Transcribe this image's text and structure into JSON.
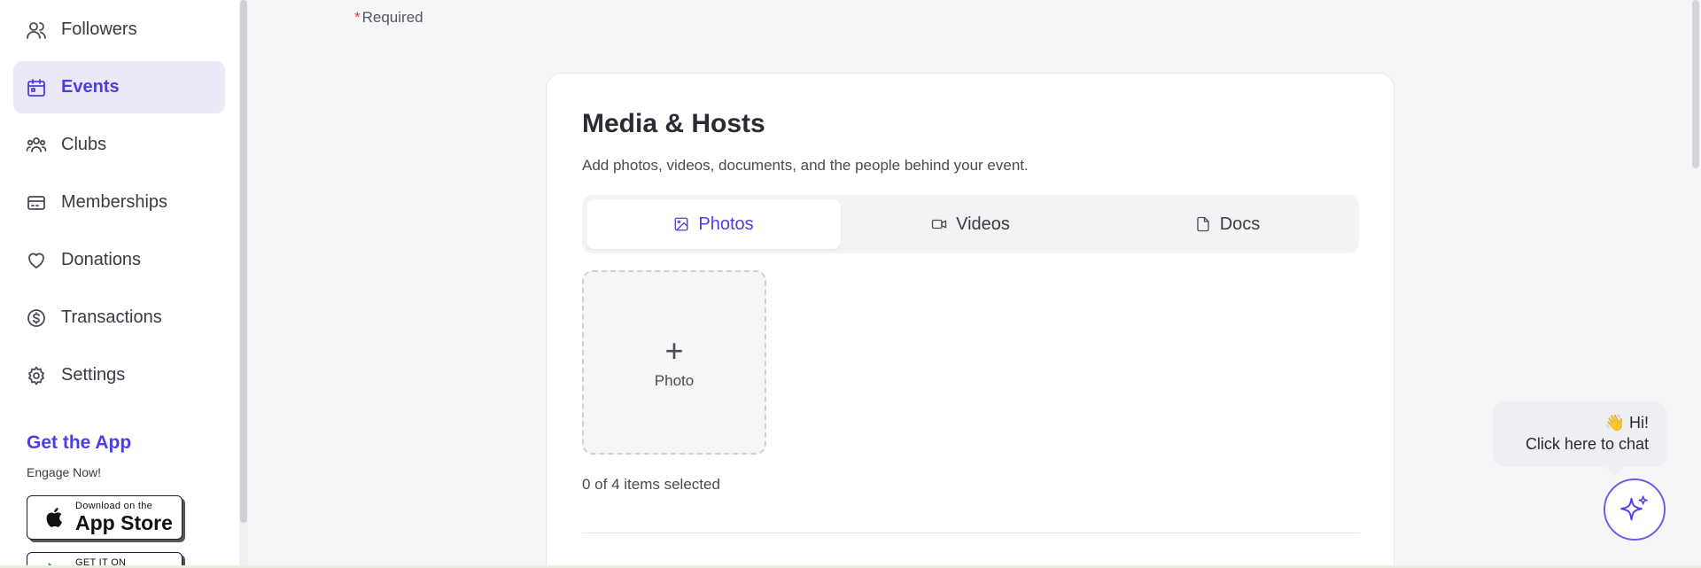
{
  "sidebar": {
    "items": [
      {
        "label": "Followers",
        "icon": "users-icon"
      },
      {
        "label": "Events",
        "icon": "calendar-icon",
        "active": true
      },
      {
        "label": "Clubs",
        "icon": "group-icon"
      },
      {
        "label": "Memberships",
        "icon": "card-icon"
      },
      {
        "label": "Donations",
        "icon": "heart-icon"
      },
      {
        "label": "Transactions",
        "icon": "dollar-circle-icon"
      },
      {
        "label": "Settings",
        "icon": "gear-icon"
      }
    ],
    "get_app": {
      "title": "Get the App",
      "subtitle": "Engage Now!",
      "app_store_small": "Download on the",
      "app_store_big": "App Store",
      "google_play_small": "GET IT ON"
    }
  },
  "form": {
    "required_star": "*",
    "required_label": "Required"
  },
  "media_card": {
    "title": "Media & Hosts",
    "description": "Add photos, videos, documents, and the people behind your event.",
    "tabs": [
      {
        "label": "Photos",
        "icon": "image-icon",
        "active": true
      },
      {
        "label": "Videos",
        "icon": "video-icon"
      },
      {
        "label": "Docs",
        "icon": "document-icon"
      }
    ],
    "upload_plus": "+",
    "upload_label": "Photo",
    "items_count": "0 of 4 items selected"
  },
  "chat": {
    "greeting": "👋 Hi!",
    "prompt": "Click here to chat",
    "icon": "sparkle-icon"
  },
  "colors": {
    "accent": "#4b3fe3",
    "active_bg": "#ebe8f7",
    "danger": "#e03a3a"
  }
}
